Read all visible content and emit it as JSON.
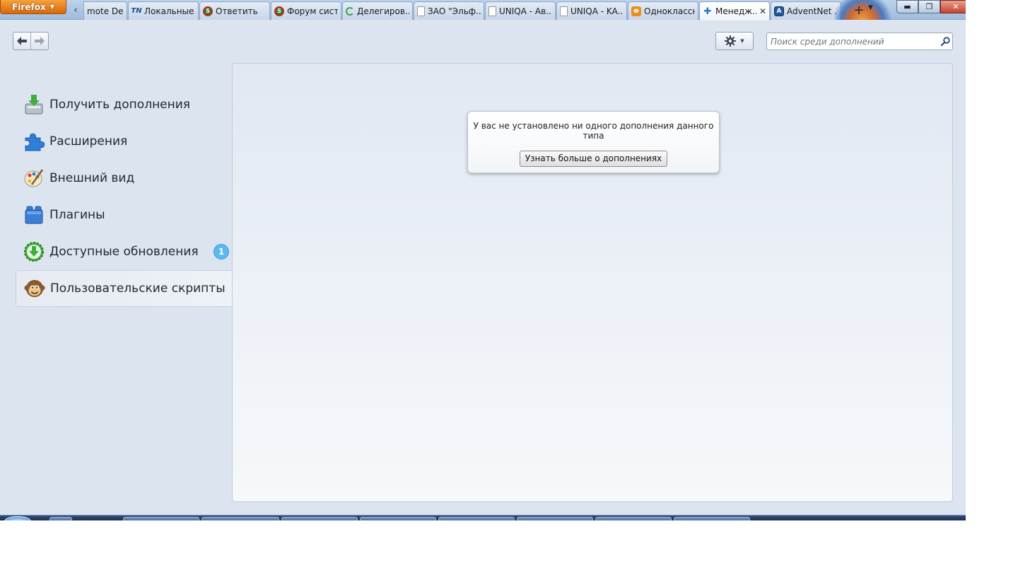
{
  "browser": {
    "menu_button_label": "Firefox",
    "tabs": [
      {
        "label": "mote De",
        "favicon": "none"
      },
      {
        "label": "Локальные...",
        "favicon": "tn-icon"
      },
      {
        "label": "Ответить",
        "favicon": "s-red-icon"
      },
      {
        "label": "Форум сист...",
        "favicon": "s-red-icon"
      },
      {
        "label": "Делегиров...",
        "favicon": "loading-spinner-icon"
      },
      {
        "label": "ЗАО \"Эльф...",
        "favicon": "page-icon"
      },
      {
        "label": "UNIQA - Ав...",
        "favicon": "page-icon"
      },
      {
        "label": "UNIQA - KA...",
        "favicon": "page-icon"
      },
      {
        "label": "Одноклассн...",
        "favicon": "odnoklassniki-icon"
      },
      {
        "label": "Менедж...",
        "favicon": "puzzle-icon",
        "selected": true
      },
      {
        "label": "AdventNet ...",
        "favicon": "adventnet-icon"
      }
    ],
    "tab_close_glyph": "✕",
    "new_tab_glyph": "+"
  },
  "toolbar": {
    "tools_icon": "gear-icon",
    "search": {
      "placeholder": "Поиск среди дополнений",
      "value": ""
    }
  },
  "sidebar": {
    "items": [
      {
        "id": "discover",
        "label": "Получить дополнения",
        "icon": "get-addons-icon"
      },
      {
        "id": "extensions",
        "label": "Расширения",
        "icon": "puzzle-piece-icon"
      },
      {
        "id": "appearance",
        "label": "Внешний вид",
        "icon": "palette-icon"
      },
      {
        "id": "plugins",
        "label": "Плагины",
        "icon": "lego-brick-icon"
      },
      {
        "id": "updates",
        "label": "Доступные обновления",
        "icon": "download-arrow-icon",
        "badge": "1"
      },
      {
        "id": "userscripts",
        "label": "Пользовательские скрипты",
        "icon": "greasemonkey-icon",
        "selected": true
      }
    ]
  },
  "main": {
    "empty_message": "У вас не установлено ни одного дополнения данного типа",
    "learn_more_label": "Узнать больше о дополнениях"
  },
  "colors": {
    "firefox_button": "#e6820f",
    "badge": "#5bb9ef",
    "background": "#dbe4ef"
  }
}
